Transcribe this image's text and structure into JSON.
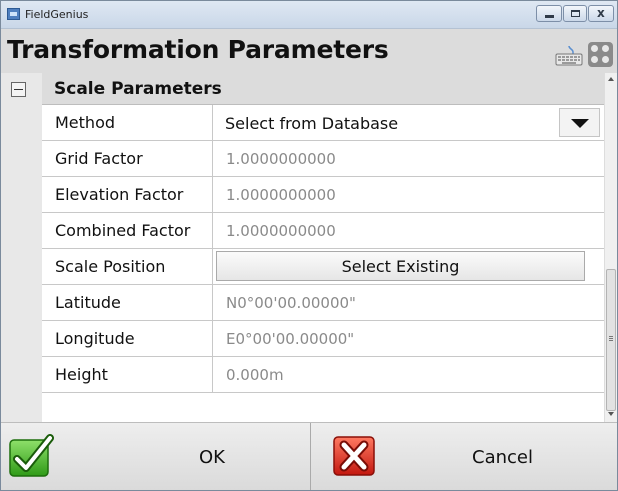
{
  "window": {
    "title": "FieldGenius"
  },
  "header": {
    "title": "Transformation Parameters",
    "icons": [
      "keyboard-icon",
      "grid-menu-icon"
    ]
  },
  "section": {
    "title": "Scale Parameters",
    "expanded": true
  },
  "rows": {
    "method": {
      "label": "Method",
      "value": "Select from Database"
    },
    "grid_factor": {
      "label": "Grid Factor",
      "value": "1.0000000000"
    },
    "elevation_factor": {
      "label": "Elevation Factor",
      "value": "1.0000000000"
    },
    "combined_factor": {
      "label": "Combined Factor",
      "value": "1.0000000000"
    },
    "scale_position": {
      "label": "Scale Position",
      "button": "Select Existing"
    },
    "latitude": {
      "label": "Latitude",
      "value": "N0°00'00.00000\""
    },
    "longitude": {
      "label": "Longitude",
      "value": "E0°00'00.00000\""
    },
    "height": {
      "label": "Height",
      "value": "0.000m"
    }
  },
  "footer": {
    "ok_label": "OK",
    "cancel_label": "Cancel"
  },
  "colors": {
    "header_bg": "#dcdcdc",
    "ok_green": "#3fae1f",
    "cancel_red": "#d92b20"
  }
}
